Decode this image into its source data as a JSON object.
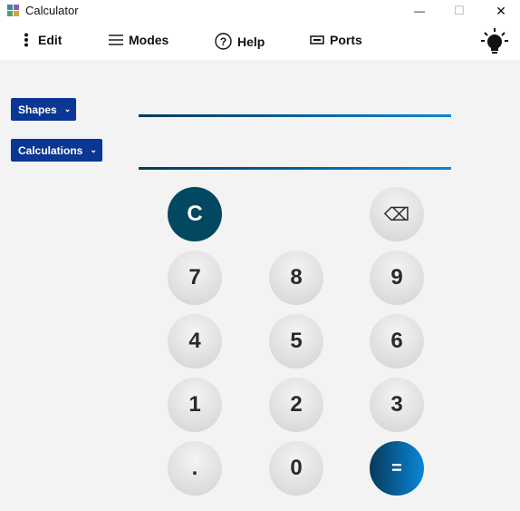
{
  "window": {
    "title": "Calculator"
  },
  "window_controls": {
    "minimize": "—",
    "maximize": "☐",
    "close": "✕"
  },
  "menu": {
    "edit": "Edit",
    "modes": "Modes",
    "help": "Help",
    "ports": "Ports"
  },
  "sidebar": {
    "shapes": "Shapes",
    "calculations": "Calculations",
    "chevron": "⌄"
  },
  "display": {
    "input_value": "",
    "result_value": ""
  },
  "keypad": {
    "clear": "C",
    "backspace": "⌫",
    "k7": "7",
    "k8": "8",
    "k9": "9",
    "k4": "4",
    "k5": "5",
    "k6": "6",
    "k1": "1",
    "k2": "2",
    "k3": "3",
    "dot": ".",
    "k0": "0",
    "equals": "="
  },
  "colors": {
    "accent_dark": "#034861",
    "accent_gradient_start": "#063a5a",
    "accent_gradient_end": "#0a86d8",
    "dropdown_bg": "#0a3694",
    "key_gray": "#dcdcdc"
  },
  "icons": {
    "edit": "vertical-dots-icon",
    "modes": "hamburger-icon",
    "help": "question-circle-icon",
    "ports": "port-icon",
    "theme": "lightbulb-icon"
  }
}
